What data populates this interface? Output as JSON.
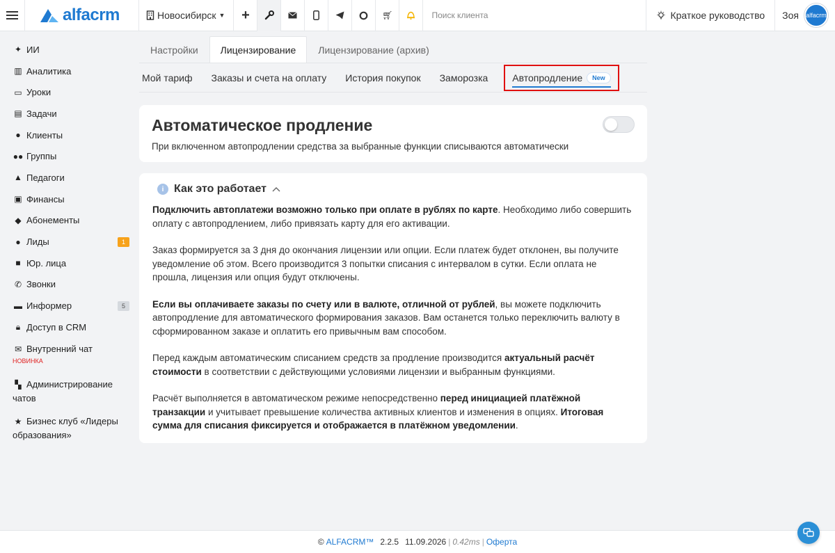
{
  "topbar": {
    "logo_text": "alfacrm",
    "branch": "Новосибирск",
    "search_placeholder": "Поиск клиента",
    "guide_label": "Краткое руководство",
    "user_name": "Зоя",
    "avatar_text": "alfacrm"
  },
  "sidebar": {
    "items": [
      {
        "label": "ИИ",
        "icon": "sparkle-icon"
      },
      {
        "label": "Аналитика",
        "icon": "map-icon"
      },
      {
        "label": "Уроки",
        "icon": "calendar-icon"
      },
      {
        "label": "Задачи",
        "icon": "clipboard-icon"
      },
      {
        "label": "Клиенты",
        "icon": "user-icon"
      },
      {
        "label": "Группы",
        "icon": "users-icon"
      },
      {
        "label": "Педагоги",
        "icon": "graduation-cap-icon"
      },
      {
        "label": "Финансы",
        "icon": "money-icon"
      },
      {
        "label": "Абонементы",
        "icon": "tag-icon"
      },
      {
        "label": "Лиды",
        "icon": "user-plus-icon",
        "badge": "1"
      },
      {
        "label": "Юр. лица",
        "icon": "briefcase-icon"
      },
      {
        "label": "Звонки",
        "icon": "phone-icon"
      },
      {
        "label": "Информер",
        "icon": "informer-icon",
        "badge": "5"
      },
      {
        "label": "Доступ в CRM",
        "icon": "lock-icon"
      }
    ],
    "chat": {
      "label": "Внутренний чат",
      "new": "НОВИНКА"
    },
    "admin_chats": "Администрирование чатов",
    "business_club": "Бизнес клуб «Лидеры образования»"
  },
  "tabs1": [
    "Настройки",
    "Лицензирование",
    "Лицензирование (архив)"
  ],
  "tabs2": [
    "Мой тариф",
    "Заказы и счета на оплату",
    "История покупок",
    "Заморозка",
    "Автопродление"
  ],
  "tabs2_new": "New",
  "autorenew": {
    "title": "Автоматическое продление",
    "description": "При включенном автопродлении средства за выбранные функции списываются автоматически",
    "enabled": false
  },
  "how": {
    "title": "Как это работает",
    "p1_bold": "Подключить автоплатежи возможно только при оплате в рублях по карте",
    "p1_rest": ". Необходимо либо совершить оплату с автопродлением, либо привязать карту для его активации.",
    "p2": "Заказ формируется за 3 дня до окончания лицензии или опции. Если платеж будет отклонен, вы получите уведомление об этом. Всего производится 3 попытки списания с интервалом в сутки. Если оплата не прошла, лицензия или опция будут отключены.",
    "p3_bold": "Если вы оплачиваете заказы по счету или в валюте, отличной от рублей",
    "p3_rest": ", вы можете подключить автопродление для автоматического формирования заказов. Вам останется только переключить валюту в сформированном заказе и оплатить его привычным вам способом.",
    "p4_a": "Перед каждым автоматическим списанием средств за продление производится ",
    "p4_bold": "актуальный расчёт стоимости",
    "p4_b": " в соответствии с действующими условиями лицензии и выбранным функциями.",
    "p5_a": "Расчёт выполняется в автоматическом режиме непосредственно ",
    "p5_bold1": "перед инициацией платёжной транзакции",
    "p5_b": " и учитывает превышение количества активных клиентов и изменения в опциях. ",
    "p5_bold2": "Итоговая сумма для списания фиксируется и отображается в платёжном уведомлении",
    "p5_c": "."
  },
  "footer": {
    "copy": "©",
    "brand": "ALFACRM™",
    "version": "2.2.5",
    "date": "11.09.2026",
    "sep": "|",
    "ms": "0.42ms",
    "offer": "Оферта"
  },
  "colors": {
    "accent": "#1f7ad1",
    "highlight_border": "#e00f0f",
    "badge_orange": "#f7a21b"
  }
}
